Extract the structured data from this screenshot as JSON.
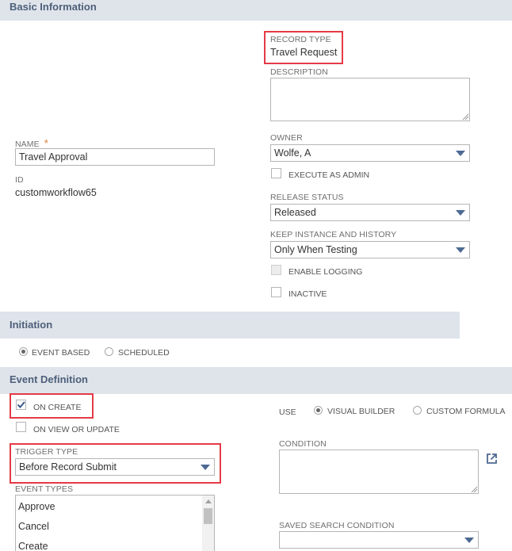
{
  "basic_info": {
    "section_title": "Basic Information",
    "record_type_label": "RECORD TYPE",
    "record_type_value": "Travel Request",
    "description_label": "DESCRIPTION",
    "description_value": "",
    "name_label": "NAME",
    "required_marker": "*",
    "name_value": "Travel Approval",
    "id_label": "ID",
    "id_value": "customworkflow65",
    "owner_label": "OWNER",
    "owner_value": "Wolfe, A",
    "execute_as_admin_label": "EXECUTE AS ADMIN",
    "release_status_label": "RELEASE STATUS",
    "release_status_value": "Released",
    "keep_instance_label": "KEEP INSTANCE AND HISTORY",
    "keep_instance_value": "Only When Testing",
    "enable_logging_label": "ENABLE LOGGING",
    "inactive_label": "INACTIVE"
  },
  "initiation": {
    "section_title": "Initiation",
    "event_based_label": "EVENT BASED",
    "scheduled_label": "SCHEDULED",
    "selected": "EVENT BASED"
  },
  "event_definition": {
    "section_title": "Event Definition",
    "on_create_label": "ON CREATE",
    "on_create_checked": true,
    "on_view_update_label": "ON VIEW OR UPDATE",
    "trigger_type_label": "TRIGGER TYPE",
    "trigger_type_value": "Before Record Submit",
    "event_types_label": "EVENT TYPES",
    "event_types": [
      "Approve",
      "Cancel",
      "Create"
    ],
    "use_label": "USE",
    "visual_builder_label": "VISUAL BUILDER",
    "custom_formula_label": "CUSTOM FORMULA",
    "use_selected": "VISUAL BUILDER",
    "condition_label": "CONDITION",
    "condition_value": "",
    "saved_search_condition_label": "SAVED SEARCH CONDITION",
    "saved_search_condition_value": ""
  },
  "colors": {
    "section_header_bg": "#dfe4eb",
    "section_header_text": "#4d5f79",
    "highlight": "#e53a47",
    "required": "#e07b2b",
    "accent": "#4d6a93"
  }
}
